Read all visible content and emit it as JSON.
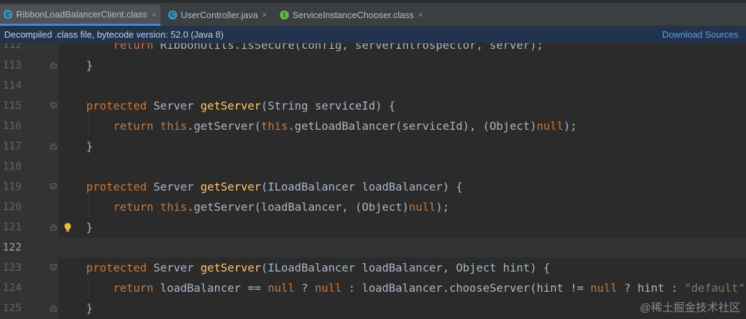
{
  "tabs": [
    {
      "label": "RibbonLoadBalancerClient.class",
      "icon": "class-c-icon",
      "active": true
    },
    {
      "label": "UserController.java",
      "icon": "class-c-icon",
      "active": false
    },
    {
      "label": "ServiceInstanceChooser.class",
      "icon": "interface-i-icon",
      "active": false
    }
  ],
  "tab_icon_letters": [
    "C",
    "C",
    "I"
  ],
  "close_glyph": "×",
  "banner": {
    "message": "Decompiled .class file, bytecode version: 52.0 (Java 8)",
    "action": "Download Sources"
  },
  "editor": {
    "current_line": 122,
    "lines": [
      {
        "n": "112",
        "tokens": [
          {
            "t": "        "
          },
          {
            "t": "return",
            "k": "kw"
          },
          {
            "t": " RibbonUtils.isSecure(config, serverIntrospector, server);"
          }
        ]
      },
      {
        "n": "113",
        "tokens": [
          {
            "t": "    }"
          }
        ]
      },
      {
        "n": "114",
        "tokens": []
      },
      {
        "n": "115",
        "tokens": [
          {
            "t": "    "
          },
          {
            "t": "protected",
            "k": "kw"
          },
          {
            "t": " Server "
          },
          {
            "t": "getServer",
            "k": "fn"
          },
          {
            "t": "(String serviceId) {"
          }
        ]
      },
      {
        "n": "116",
        "tokens": [
          {
            "t": "        "
          },
          {
            "t": "return",
            "k": "kw"
          },
          {
            "t": " "
          },
          {
            "t": "this",
            "k": "kw"
          },
          {
            "t": ".getServer("
          },
          {
            "t": "this",
            "k": "kw"
          },
          {
            "t": ".getLoadBalancer(serviceId), (Object)"
          },
          {
            "t": "null",
            "k": "kw"
          },
          {
            "t": ");"
          }
        ]
      },
      {
        "n": "117",
        "tokens": [
          {
            "t": "    }"
          }
        ]
      },
      {
        "n": "118",
        "tokens": []
      },
      {
        "n": "119",
        "tokens": [
          {
            "t": "    "
          },
          {
            "t": "protected",
            "k": "kw"
          },
          {
            "t": " Server "
          },
          {
            "t": "getServer",
            "k": "fn"
          },
          {
            "t": "(ILoadBalancer loadBalancer) {"
          }
        ]
      },
      {
        "n": "120",
        "tokens": [
          {
            "t": "        "
          },
          {
            "t": "return",
            "k": "kw"
          },
          {
            "t": " "
          },
          {
            "t": "this",
            "k": "kw"
          },
          {
            "t": ".getServer(loadBalancer, (Object)"
          },
          {
            "t": "null",
            "k": "kw"
          },
          {
            "t": ");"
          }
        ]
      },
      {
        "n": "121",
        "tokens": [
          {
            "t": "    }"
          }
        ]
      },
      {
        "n": "122",
        "tokens": []
      },
      {
        "n": "123",
        "tokens": [
          {
            "t": "    "
          },
          {
            "t": "protected",
            "k": "kw"
          },
          {
            "t": " Server "
          },
          {
            "t": "getServer",
            "k": "fn"
          },
          {
            "t": "(ILoadBalancer loadBalancer, Object hint) {"
          }
        ]
      },
      {
        "n": "124",
        "tokens": [
          {
            "t": "        "
          },
          {
            "t": "return",
            "k": "kw"
          },
          {
            "t": " loadBalancer == "
          },
          {
            "t": "null",
            "k": "kw"
          },
          {
            "t": " ? "
          },
          {
            "t": "null",
            "k": "kw"
          },
          {
            "t": " : loadBalancer.chooseServer(hint != "
          },
          {
            "t": "null",
            "k": "kw"
          },
          {
            "t": " ? hint : "
          },
          {
            "t": "\"default\"",
            "k": "str"
          },
          {
            "t": ");"
          }
        ]
      },
      {
        "n": "125",
        "tokens": [
          {
            "t": "    }"
          }
        ]
      }
    ]
  },
  "watermark": "@稀土掘金技术社区",
  "colors": {
    "keyword": "#cc7832",
    "method": "#ffc66d",
    "string": "#6a8759",
    "text": "#a9b7c6",
    "banner_link": "#589df6"
  }
}
